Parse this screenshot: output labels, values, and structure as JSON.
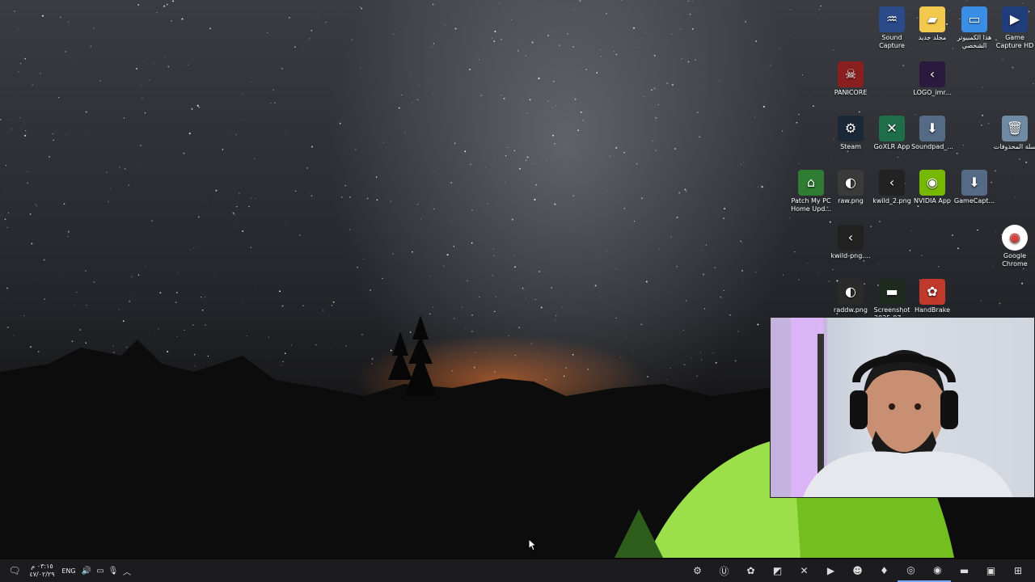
{
  "desktop": {
    "icons": [
      {
        "label": "Sound Capture",
        "icon": "waveform-icon",
        "color": "#2b4a8a"
      },
      {
        "label": "مجلد جديد",
        "icon": "folder-icon",
        "color": "#f2c94c"
      },
      {
        "label": "هذا الكمبيوتر الشخصي",
        "icon": "computer-icon",
        "color": "#3a8ee6"
      },
      {
        "label": "Game Capture HD",
        "icon": "play-icon",
        "color": "#1f3d7a"
      },
      {
        "label": "PANICORE",
        "icon": "game-icon",
        "color": "#8a1f1f"
      },
      {
        "label": "LOGO_imr...",
        "icon": "logo-icon",
        "color": "#2a1a3e"
      },
      {
        "label": "Steam",
        "icon": "steam-icon",
        "color": "#1b2838"
      },
      {
        "label": "GoXLR App",
        "icon": "goxlr-icon",
        "color": "#1f6e4a"
      },
      {
        "label": "Soundpad_...",
        "icon": "installer-icon",
        "color": "#556a85"
      },
      {
        "label": "سلة المحذوفات",
        "icon": "recycle-bin-icon",
        "color": "#6f8aa3"
      },
      {
        "label": "Patch My PC Home Upd...",
        "icon": "patch-icon",
        "color": "#2e7d32"
      },
      {
        "label": "raw.png",
        "icon": "image-icon",
        "color": "#3a3a3a"
      },
      {
        "label": "kwild_2.png",
        "icon": "kwild-icon",
        "color": "#222"
      },
      {
        "label": "NVIDIA App",
        "icon": "nvidia-icon",
        "color": "#76b900"
      },
      {
        "label": "GameCapt...",
        "icon": "installer-icon",
        "color": "#556a85"
      },
      {
        "label": "kwild-png....",
        "icon": "kwild-icon",
        "color": "#222"
      },
      {
        "label": "Google Chrome",
        "icon": "chrome-icon",
        "color": "#ffffff"
      },
      {
        "label": "raddw.png",
        "icon": "image-icon",
        "color": "#2a2a2a"
      },
      {
        "label": "Screenshot 2025-07-...",
        "icon": "screenshot-icon",
        "color": "#1e2a1e"
      },
      {
        "label": "HandBrake",
        "icon": "handbrake-icon",
        "color": "#c0392b"
      }
    ]
  },
  "taskbar": {
    "apps": [
      {
        "name": "windows-start-icon",
        "glyph": "⊞",
        "running": false
      },
      {
        "name": "microsoft-store-icon",
        "glyph": "▣",
        "running": false
      },
      {
        "name": "file-explorer-icon",
        "glyph": "▬",
        "running": false
      },
      {
        "name": "chrome-icon",
        "glyph": "◉",
        "running": true
      },
      {
        "name": "obs-icon",
        "glyph": "◎",
        "running": true
      },
      {
        "name": "app-red-icon",
        "glyph": "♦",
        "running": false
      },
      {
        "name": "discord-icon",
        "glyph": "☻",
        "running": false
      },
      {
        "name": "game-capture-icon",
        "glyph": "▶",
        "running": false
      },
      {
        "name": "goxlr-icon",
        "glyph": "✕",
        "running": false
      },
      {
        "name": "capture-tool-icon",
        "glyph": "◩",
        "running": false
      },
      {
        "name": "handbrake-icon",
        "glyph": "✿",
        "running": false
      },
      {
        "name": "utorrent-icon",
        "glyph": "Ⓤ",
        "running": false
      },
      {
        "name": "steam-icon",
        "glyph": "⚙",
        "running": false
      }
    ],
    "language": "ENG",
    "time": "٠٣:١٥ م",
    "date": "٤٧/٠٢/٢٩"
  }
}
